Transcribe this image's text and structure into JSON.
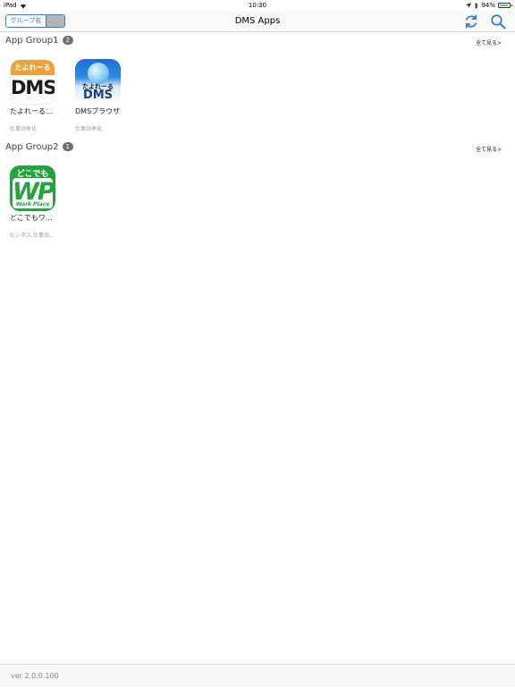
{
  "status_bar": {
    "device": "iPad",
    "time": "10:30",
    "battery_percent": "94%",
    "battery_level": 0.94
  },
  "navbar": {
    "segment_label": "グループ名",
    "title": "DMS Apps",
    "accent_color": "#2f7bd6"
  },
  "groups": [
    {
      "title": "App Group1",
      "count": "2",
      "see_all": "全て見る>",
      "apps": [
        {
          "name": "たよれーる…",
          "category": "仕事効率化",
          "icon_top": "たよれーる",
          "icon_main": "DMS"
        },
        {
          "name": "DMSブラウザ",
          "category": "仕事効率化",
          "icon_top": "たよれーる",
          "icon_main": "DMS"
        }
      ]
    },
    {
      "title": "App Group2",
      "count": "1",
      "see_all": "全て見る>",
      "apps": [
        {
          "name": "どこでもワ…",
          "category": "ビジネス,仕事効…",
          "icon_top": "どこでも",
          "icon_main": "WP",
          "icon_sub": "Work Place"
        }
      ]
    }
  ],
  "footer": {
    "version": "ver 2.0.0.100"
  }
}
